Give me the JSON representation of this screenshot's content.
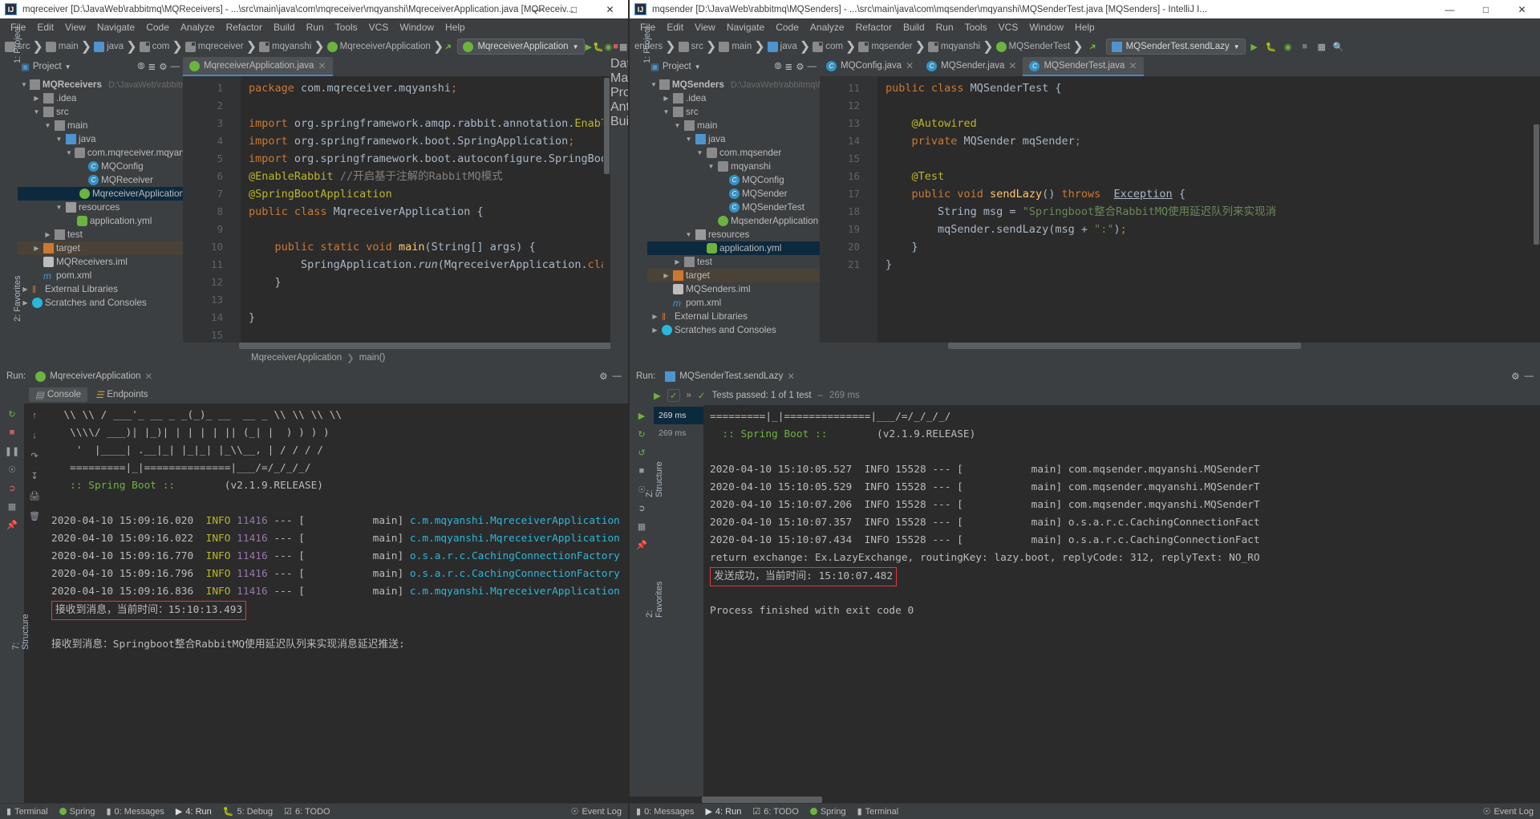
{
  "left": {
    "titlebar": {
      "text": "mqreceiver [D:\\JavaWeb\\rabbitmq\\MQReceivers] - ...\\src\\main\\java\\com\\mqreceiver\\mqyanshi\\MqreceiverApplication.java [MQReceiv...",
      "minimize": "—",
      "maximize": "□",
      "close": "✕"
    },
    "menu": [
      "File",
      "Edit",
      "View",
      "Navigate",
      "Code",
      "Analyze",
      "Refactor",
      "Build",
      "Run",
      "Tools",
      "VCS",
      "Window",
      "Help"
    ],
    "breadcrumbs": [
      "src",
      "main",
      "java",
      "com",
      "mqreceiver",
      "mqyanshi",
      "MqreceiverApplication"
    ],
    "run_config": "MqreceiverApplication",
    "project_panel": {
      "title": "Project"
    },
    "tree": [
      {
        "indent": 0,
        "arrow": "▼",
        "icon": "module",
        "label": "MQReceivers",
        "sub": "D:\\JavaWeb\\rabbitmq\\M",
        "bold": true
      },
      {
        "indent": 1,
        "arrow": "▶",
        "icon": "folder",
        "label": ".idea"
      },
      {
        "indent": 1,
        "arrow": "▼",
        "icon": "folder",
        "label": "src"
      },
      {
        "indent": 2,
        "arrow": "▼",
        "icon": "folder",
        "label": "main"
      },
      {
        "indent": 3,
        "arrow": "▼",
        "icon": "folder-blue",
        "label": "java"
      },
      {
        "indent": 4,
        "arrow": "▼",
        "icon": "pkg",
        "label": "com.mqreceiver.mqyanshi"
      },
      {
        "indent": 5,
        "arrow": "",
        "icon": "class",
        "label": "MQConfig"
      },
      {
        "indent": 5,
        "arrow": "",
        "icon": "class",
        "label": "MQReceiver"
      },
      {
        "indent": 5,
        "arrow": "",
        "icon": "spring",
        "label": "MqreceiverApplication",
        "selected": true
      },
      {
        "indent": 3,
        "arrow": "▼",
        "icon": "resources",
        "label": "resources"
      },
      {
        "indent": 4,
        "arrow": "",
        "icon": "yml",
        "label": "application.yml"
      },
      {
        "indent": 2,
        "arrow": "▶",
        "icon": "folder",
        "label": "test"
      },
      {
        "indent": 1,
        "arrow": "▶",
        "icon": "folder-orange",
        "label": "target",
        "selected2": true
      },
      {
        "indent": 1,
        "arrow": "",
        "icon": "iml",
        "label": "MQReceivers.iml"
      },
      {
        "indent": 1,
        "arrow": "",
        "icon": "maven",
        "label": "pom.xml"
      },
      {
        "indent": 0,
        "arrow": "▶",
        "icon": "libs",
        "label": "External Libraries"
      },
      {
        "indent": 0,
        "arrow": "▶",
        "icon": "scratch",
        "label": "Scratches and Consoles"
      }
    ],
    "editor_tab": "MqreceiverApplication.java",
    "code_lines": [
      {
        "n": 1,
        "html": "<span class='kw'>package</span> com.mqreceiver.mqyanshi<span class='kw'>;</span>"
      },
      {
        "n": 2,
        "html": ""
      },
      {
        "n": 3,
        "html": "<span class='kw'>import</span> org.springframework.amqp.rabbit.annotation.<span class='ann'>EnableRabb</span>"
      },
      {
        "n": 4,
        "html": "<span class='kw'>import</span> org.springframework.boot.SpringApplication<span class='kw'>;</span>"
      },
      {
        "n": 5,
        "html": "<span class='kw'>import</span> org.springframework.boot.autoconfigure.<span class='typ'>SpringBootAppl</span>"
      },
      {
        "n": 6,
        "html": "<span class='ann'>@EnableRabbit</span> <span class='cmt'>//开启基于注解的RabbitMQ模式</span>"
      },
      {
        "n": 7,
        "html": "<span class='ann'>@SpringBootApplication</span>"
      },
      {
        "n": 8,
        "html": "<span class='kw'>public class</span> MqreceiverApplication {"
      },
      {
        "n": 9,
        "html": ""
      },
      {
        "n": 10,
        "html": "    <span class='kw'>public static void</span> <span class='fn'>main</span>(String[] args) {"
      },
      {
        "n": 11,
        "html": "        SpringApplication.<span class='ital'>run</span>(MqreceiverApplication.<span class='kw'>class</span>, ar"
      },
      {
        "n": 12,
        "html": "    }"
      },
      {
        "n": 13,
        "html": ""
      },
      {
        "n": 14,
        "html": "}"
      },
      {
        "n": 15,
        "html": ""
      }
    ],
    "bottom_breadcrumb": [
      "MqreceiverApplication",
      "main()"
    ],
    "run_label": "Run:",
    "run_tab": "MqreceiverApplication",
    "console_tabs": [
      "Console",
      "Endpoints"
    ],
    "console_lines": [
      {
        "html": "  \\\\ \\\\ / ___'_ __ _ _(_)_ __  __ _ \\\\ \\\\ \\\\ \\\\"
      },
      {
        "html": "   \\\\\\\\/ ___)| |_)| | | | | || (_| |  ) ) ) )"
      },
      {
        "html": "    '  |____| .__|_| |_|_| |_\\\\__, | / / / /"
      },
      {
        "html": "   =========|_|==============|___/=/_/_/_/"
      },
      {
        "html": "   <span class='g'>:: Spring Boot ::</span>        (v2.1.9.RELEASE)"
      },
      {
        "html": ""
      },
      {
        "html": "2020-04-10 15:09:16.020  <span class='y'>INFO</span> <span class='mag'>11416</span> --- [           main] <span class='cy'>c.m.mqyanshi.MqreceiverApplication</span>"
      },
      {
        "html": "2020-04-10 15:09:16.022  <span class='y'>INFO</span> <span class='mag'>11416</span> --- [           main] <span class='cy'>c.m.mqyanshi.MqreceiverApplication</span>"
      },
      {
        "html": "2020-04-10 15:09:16.770  <span class='y'>INFO</span> <span class='mag'>11416</span> --- [           main] <span class='cy'>o.s.a.r.c.CachingConnectionFactory</span>"
      },
      {
        "html": "2020-04-10 15:09:16.796  <span class='y'>INFO</span> <span class='mag'>11416</span> --- [           main] <span class='cy'>o.s.a.r.c.CachingConnectionFactory</span>"
      },
      {
        "html": "2020-04-10 15:09:16.836  <span class='y'>INFO</span> <span class='mag'>11416</span> --- [           main] <span class='cy'>c.m.mqyanshi.MqreceiverApplication</span>"
      },
      {
        "html": "<span class='hl-box'>接收到消息，当前时间：15:10:13.493</span>"
      },
      {
        "html": ""
      },
      {
        "html": "接收到消息：Springboot整合RabbitMQ使用延迟队列来实现消息延迟推送:"
      }
    ],
    "statusbar": [
      "Terminal",
      "Spring",
      "0: Messages",
      "4: Run",
      "5: Debug",
      "6: TODO"
    ],
    "statusbar_right": "Event Log",
    "side_labels": {
      "left_top": "1: Project",
      "left_bottom": "2: Favorites",
      "left_struct": "7: Structure",
      "right_top": "Database",
      "right_mid": "Maven Projects",
      "right_bottom": "Ant Build"
    }
  },
  "right": {
    "titlebar": {
      "text": "mqsender [D:\\JavaWeb\\rabbitmq\\MQSenders] - ...\\src\\main\\java\\com\\mqsender\\mqyanshi\\MQSenderTest.java [MQSenders] - IntelliJ I...",
      "minimize": "—",
      "maximize": "□",
      "close": "✕"
    },
    "menu": [
      "File",
      "Edit",
      "View",
      "Navigate",
      "Code",
      "Analyze",
      "Refactor",
      "Build",
      "Run",
      "Tools",
      "VCS",
      "Window",
      "Help"
    ],
    "breadcrumbs": [
      "enders",
      "src",
      "main",
      "java",
      "com",
      "mqsender",
      "mqyanshi",
      "MQSenderTest"
    ],
    "run_config": "MQSenderTest.sendLazy",
    "project_panel": {
      "title": "Project"
    },
    "tree": [
      {
        "indent": 0,
        "arrow": "▼",
        "icon": "module",
        "label": "MQSenders",
        "sub": "D:\\JavaWeb\\rabbitmq\\MQ",
        "bold": true
      },
      {
        "indent": 1,
        "arrow": "▶",
        "icon": "folder",
        "label": ".idea"
      },
      {
        "indent": 1,
        "arrow": "▼",
        "icon": "folder",
        "label": "src"
      },
      {
        "indent": 2,
        "arrow": "▼",
        "icon": "folder",
        "label": "main"
      },
      {
        "indent": 3,
        "arrow": "▼",
        "icon": "folder-blue",
        "label": "java"
      },
      {
        "indent": 4,
        "arrow": "▼",
        "icon": "pkg",
        "label": "com.mqsender"
      },
      {
        "indent": 5,
        "arrow": "▼",
        "icon": "pkg",
        "label": "mqyanshi"
      },
      {
        "indent": 6,
        "arrow": "",
        "icon": "class",
        "label": "MQConfig"
      },
      {
        "indent": 6,
        "arrow": "",
        "icon": "class",
        "label": "MQSender"
      },
      {
        "indent": 6,
        "arrow": "",
        "icon": "class",
        "label": "MQSenderTest"
      },
      {
        "indent": 5,
        "arrow": "",
        "icon": "spring",
        "label": "MqsenderApplication"
      },
      {
        "indent": 3,
        "arrow": "▼",
        "icon": "resources",
        "label": "resources"
      },
      {
        "indent": 4,
        "arrow": "",
        "icon": "yml",
        "label": "application.yml",
        "selected": true
      },
      {
        "indent": 2,
        "arrow": "▶",
        "icon": "folder",
        "label": "test"
      },
      {
        "indent": 1,
        "arrow": "▶",
        "icon": "folder-orange",
        "label": "target",
        "selected2": true
      },
      {
        "indent": 1,
        "arrow": "",
        "icon": "iml",
        "label": "MQSenders.iml"
      },
      {
        "indent": 1,
        "arrow": "",
        "icon": "maven",
        "label": "pom.xml"
      },
      {
        "indent": 0,
        "arrow": "▶",
        "icon": "libs",
        "label": "External Libraries"
      },
      {
        "indent": 0,
        "arrow": "▶",
        "icon": "scratch",
        "label": "Scratches and Consoles"
      }
    ],
    "editor_tabs": [
      {
        "label": "MQConfig.java",
        "active": false
      },
      {
        "label": "MQSender.java",
        "active": false
      },
      {
        "label": "MQSenderTest.java",
        "active": true
      }
    ],
    "code_lines": [
      {
        "n": 11,
        "html": "<span class='kw'>public class</span> MQSenderTest {"
      },
      {
        "n": 12,
        "html": ""
      },
      {
        "n": 13,
        "html": "    <span class='ann'>@Autowired</span>"
      },
      {
        "n": 14,
        "html": "    <span class='kw'>private</span> MQSender mqSender<span class='kw'>;</span>"
      },
      {
        "n": 15,
        "html": ""
      },
      {
        "n": 16,
        "html": "    <span class='ann'>@Test</span>"
      },
      {
        "n": 17,
        "html": "    <span class='kw'>public void</span> <span class='fn'>sendLazy</span>() <span class='kw'>throws</span>  <u>Exception</u> {"
      },
      {
        "n": 18,
        "html": "        String msg = <span class='str'>\"Springboot整合RabbitMQ使用延迟队列来实现消</span>"
      },
      {
        "n": 19,
        "html": "        mqSender.sendLazy(msg + <span class='str'>\":\"</span>)<span class='kw'>;</span>"
      },
      {
        "n": 20,
        "html": "    }"
      },
      {
        "n": 21,
        "html": "}"
      }
    ],
    "run_label": "Run:",
    "run_tab": "MQSenderTest.sendLazy",
    "test_status": "Tests passed: 1 of 1 test",
    "test_duration": "269 ms",
    "test_tree": [
      {
        "label": "269 ms",
        "selected": true
      },
      {
        "label": "269 ms",
        "selected": false
      }
    ],
    "console_lines": [
      {
        "html": "=========|_|==============|___/=/_/_/_/"
      },
      {
        "html": "  <span class='g'>:: Spring Boot ::</span>        (v2.1.9.RELEASE)"
      },
      {
        "html": ""
      },
      {
        "html": "2020-04-10 15:10:05.527  INFO 15528 --- [           main] com.mqsender.mqyanshi.MQSenderT"
      },
      {
        "html": "2020-04-10 15:10:05.529  INFO 15528 --- [           main] com.mqsender.mqyanshi.MQSenderT"
      },
      {
        "html": "2020-04-10 15:10:07.206  INFO 15528 --- [           main] com.mqsender.mqyanshi.MQSenderT"
      },
      {
        "html": "2020-04-10 15:10:07.357  INFO 15528 --- [           main] o.s.a.r.c.CachingConnectionFact"
      },
      {
        "html": "2020-04-10 15:10:07.434  INFO 15528 --- [           main] o.s.a.r.c.CachingConnectionFact"
      },
      {
        "html": "return exchange: Ex.LazyExchange, routingKey: lazy.boot, replyCode: 312, replyText: NO_RO"
      },
      {
        "html": "<span class='hl-box'>发送成功，当前时间: 15:10:07.482</span>"
      },
      {
        "html": ""
      },
      {
        "html": "Process finished with exit code 0"
      }
    ],
    "statusbar": [
      "0: Messages",
      "4: Run",
      "6: TODO",
      "Spring",
      "Terminal"
    ],
    "statusbar_right": "Event Log",
    "side_labels": {
      "left_top": "1: Project",
      "left_bottom": "2: Favorites",
      "left_struct": "Z: Structure"
    }
  },
  "colors": {
    "accent_blue": "#4a88c7",
    "spring_green": "#6db33f",
    "highlight_red": "#e53935",
    "panel_bg": "#3c3f41",
    "editor_bg": "#2b2b2b"
  }
}
